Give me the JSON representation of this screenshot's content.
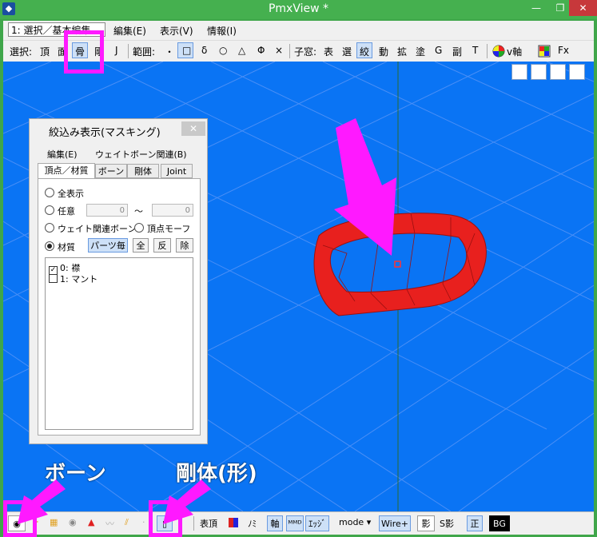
{
  "window": {
    "title": "PmxView *",
    "app_icon": "pmx-app-icon",
    "min_label": "—",
    "max_label": "❐",
    "close_label": "✕"
  },
  "menubar": {
    "mode_select": "1: 選択／基本編集",
    "items": [
      "編集(E)",
      "表示(V)",
      "情報(I)"
    ]
  },
  "toolbar": {
    "select_label": "選択:",
    "select_items": [
      "頂",
      "面",
      "骨",
      "剛",
      "J"
    ],
    "range_label": "範囲:",
    "range_items": [
      "・",
      "□",
      "δ",
      "○",
      "△",
      "Φ",
      "×"
    ],
    "child_label": "子窓:",
    "child_items": [
      "表",
      "選",
      "絞",
      "動",
      "拡",
      "塗",
      "G",
      "副",
      "T"
    ],
    "v_axis": "v軸",
    "fx": "Fx"
  },
  "panel": {
    "title": "絞込み表示(マスキング)",
    "close": "✕",
    "menu": [
      "編集(E)",
      "ウェイトボーン関連(B)"
    ],
    "tabs": [
      "頂点／材質",
      "ボーン",
      "剛体",
      "Joint"
    ],
    "radio_all": "全表示",
    "radio_any": "任意",
    "any_from": "0",
    "range_sep": "〜",
    "any_to": "0",
    "radio_weight": "ウェイト関連ボーン",
    "radio_morph": "頂点モーフ",
    "radio_material": "材質",
    "btn_parts": "パーツ毎",
    "btn_all": "全",
    "btn_invert": "反",
    "btn_remove": "除",
    "materials": [
      {
        "label": "0: 襟",
        "checked": true
      },
      {
        "label": "1: マント",
        "checked": false
      }
    ]
  },
  "status": {
    "items": [
      "表頂",
      "ﾉﾐ",
      "軸",
      "ｴｯｼﾞ",
      "mode",
      "Wire+",
      "影",
      "S影",
      "正",
      "BG"
    ]
  },
  "annotations": {
    "bone_label": "ボーン",
    "rigid_label": "剛体(形)"
  },
  "colors": {
    "viewport": "#0a74f4",
    "ring": "#e8201e",
    "annotation": "#ff19ff",
    "titlebar": "#45b04f"
  }
}
